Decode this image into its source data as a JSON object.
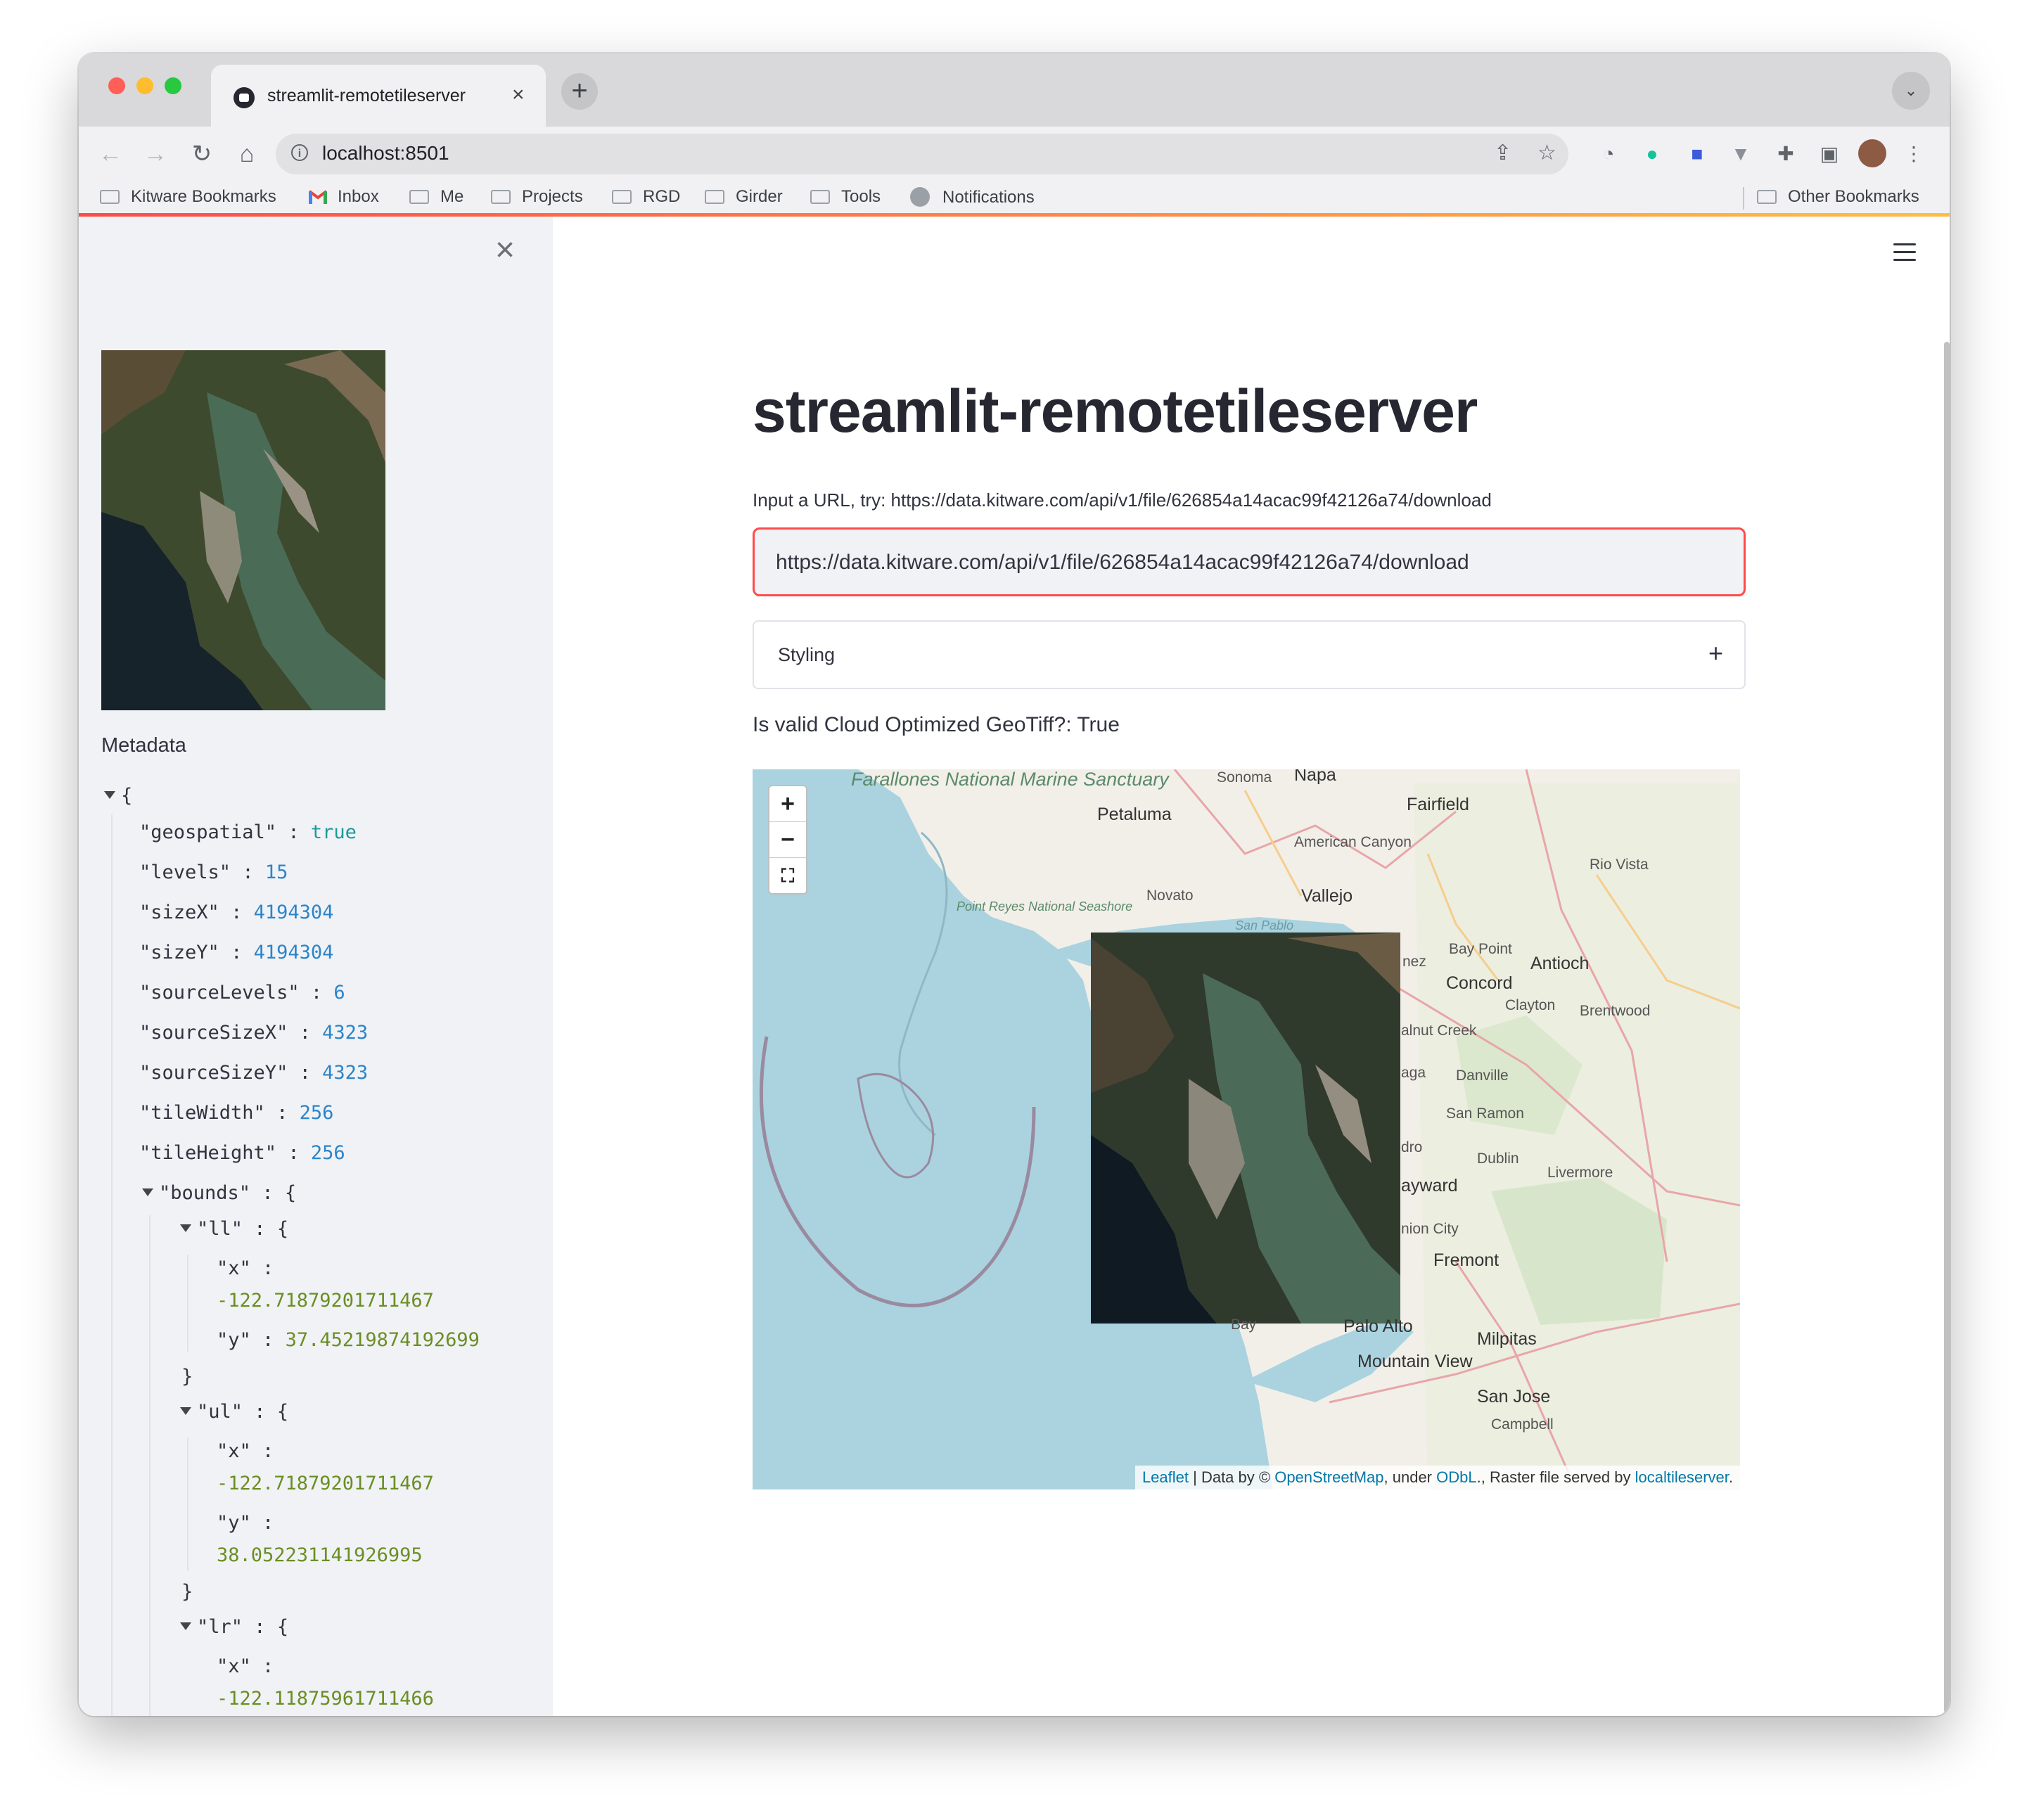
{
  "browser": {
    "tab_title": "streamlit-remotetileserver",
    "tab_close": "×",
    "new_tab": "+",
    "url": "localhost:8501",
    "bookmarks": [
      {
        "label": "Kitware Bookmarks",
        "icon": "folder-icon"
      },
      {
        "label": "Inbox",
        "icon": "gmail-icon"
      },
      {
        "label": "Me",
        "icon": "folder-icon"
      },
      {
        "label": "Projects",
        "icon": "folder-icon"
      },
      {
        "label": "RGD",
        "icon": "folder-icon"
      },
      {
        "label": "Girder",
        "icon": "folder-icon"
      },
      {
        "label": "Tools",
        "icon": "folder-icon"
      },
      {
        "label": "Notifications",
        "icon": "github-icon"
      }
    ],
    "other_bookmarks": "Other Bookmarks"
  },
  "sidebar": {
    "close": "×",
    "metadata_label": "Metadata",
    "json": {
      "open_brace": "{",
      "geospatial": {
        "key": "\"geospatial\"",
        "value": "true"
      },
      "levels": {
        "key": "\"levels\"",
        "value": "15"
      },
      "sizeX": {
        "key": "\"sizeX\"",
        "value": "4194304"
      },
      "sizeY": {
        "key": "\"sizeY\"",
        "value": "4194304"
      },
      "sourceLevels": {
        "key": "\"sourceLevels\"",
        "value": "6"
      },
      "sourceSizeX": {
        "key": "\"sourceSizeX\"",
        "value": "4323"
      },
      "sourceSizeY": {
        "key": "\"sourceSizeY\"",
        "value": "4323"
      },
      "tileWidth": {
        "key": "\"tileWidth\"",
        "value": "256"
      },
      "tileHeight": {
        "key": "\"tileHeight\"",
        "value": "256"
      },
      "bounds_key": "\"bounds\"",
      "ll": {
        "key": "\"ll\"",
        "x_key": "\"x\"",
        "x": "-122.71879201711467",
        "y_key": "\"y\"",
        "y": "37.45219874192699"
      },
      "ul": {
        "key": "\"ul\"",
        "x_key": "\"x\"",
        "x": "-122.71879201711467",
        "y_key": "\"y\"",
        "y": "38.052231141926995"
      },
      "lr": {
        "key": "\"lr\"",
        "x_key": "\"x\"",
        "x": "-122.11875961711466"
      },
      "colon": ":",
      "open_obj": "{",
      "close_obj": "}"
    }
  },
  "main": {
    "title": "streamlit-remotetileserver",
    "hint": "Input a URL, try: https://data.kitware.com/api/v1/file/626854a14acac99f42126a74/download",
    "url_value": "https://data.kitware.com/api/v1/file/626854a14acac99f42126a74/download",
    "styling_label": "Styling",
    "styling_toggle": "+",
    "valid_text": "Is valid Cloud Optimized GeoTiff?: True"
  },
  "map": {
    "zoom_in": "+",
    "zoom_out": "−",
    "fullscreen": "⛶",
    "attribution": {
      "leaflet": "Leaflet",
      "sep1": " | Data by © ",
      "osm": "OpenStreetMap",
      "sep2": ", under ",
      "odbl": "ODbL",
      "sep3": "., Raster file served by ",
      "server": "localtileserver",
      "end": "."
    },
    "places": {
      "sanctuary": "Farallones National Marine Sanctuary",
      "pointreyes": "Point Reyes National Seashore",
      "sonoma": "Sonoma",
      "napa": "Napa",
      "petaluma": "Petaluma",
      "fairfield": "Fairfield",
      "americancanyon": "American Canyon",
      "riovista": "Rio Vista",
      "novato": "Novato",
      "vallejo": "Vallejo",
      "sanpablo": "San Pablo",
      "baypoint": "Bay Point",
      "antioch": "Antioch",
      "concord": "Concord",
      "clayton": "Clayton",
      "brentwood": "Brentwood",
      "walnutcreek": "alnut Creek",
      "danville": "Danville",
      "sanramon": "San Ramon",
      "dublin": "Dublin",
      "livermore": "Livermore",
      "hayward": "ayward",
      "fremont": "Fremont",
      "paloalto": "Palo Alto",
      "milpitas": "Milpitas",
      "mountainview": "Mountain View",
      "sanjose": "San Jose",
      "campbell": "Campbell",
      "bay": "Bay",
      "unioncity": "nion City",
      "nez": "nez",
      "aga": "aga",
      "dro": "dro"
    }
  }
}
